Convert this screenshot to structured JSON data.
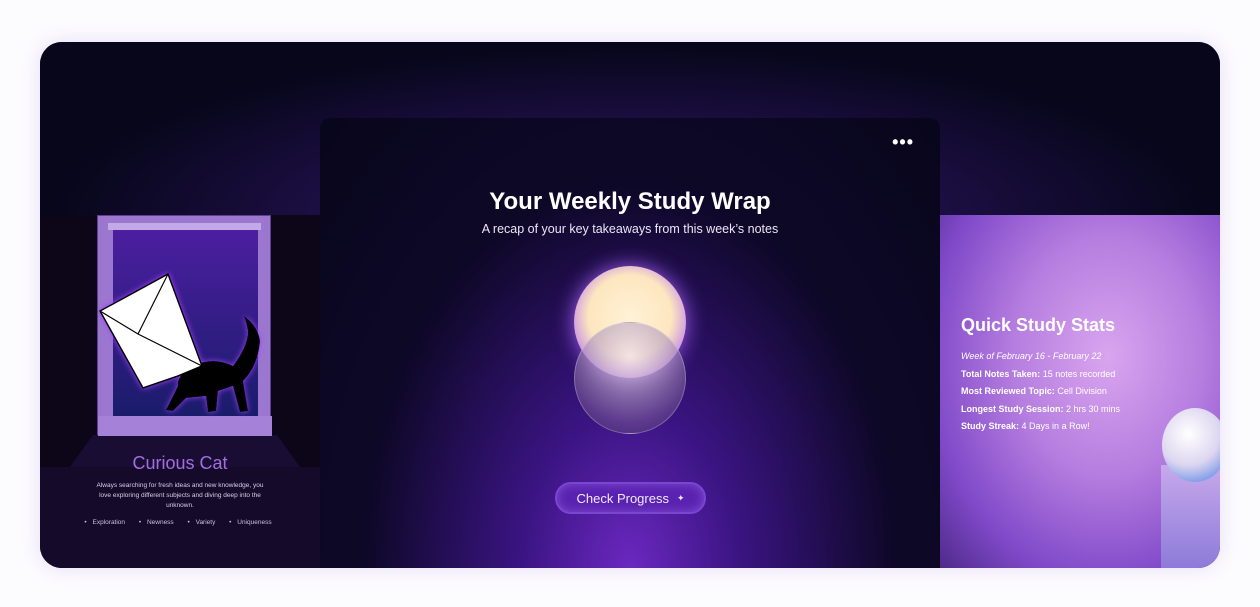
{
  "left_card": {
    "title": "Curious Cat",
    "description": "Always searching for fresh ideas and new knowledge, you love exploring different subjects and diving deep into the unknown.",
    "tags": [
      "Exploration",
      "Newness",
      "Variety",
      "Uniqueness"
    ]
  },
  "main_card": {
    "title": "Your Weekly Study Wrap",
    "subtitle": "A recap of your key takeaways from this week’s notes",
    "menu_icon": "more-horizontal-icon",
    "menu_glyph": "•••",
    "button_label": "Check Progress",
    "button_icon": "sparkle-icon",
    "button_glyph": "✦"
  },
  "right_card": {
    "title": "Quick Study Stats",
    "week": "Week of February 16 - February 22",
    "stats": [
      {
        "label": "Total Notes Taken:",
        "value": "15 notes recorded"
      },
      {
        "label": "Most Reviewed Topic:",
        "value": "Cell Division"
      },
      {
        "label": "Longest Study Session:",
        "value": "2 hrs 30 mins"
      },
      {
        "label": "Study Streak:",
        "value": "4 Days in a Row!"
      }
    ]
  }
}
